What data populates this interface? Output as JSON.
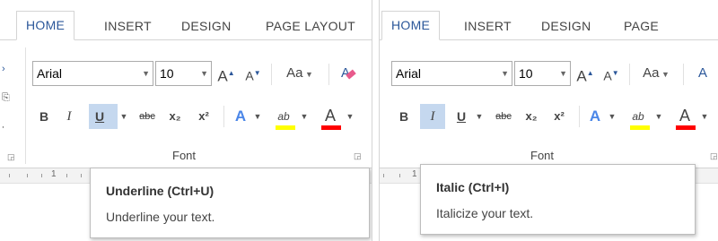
{
  "tabs": [
    "HOME",
    "INSERT",
    "DESIGN",
    "PAGE LAYOUT"
  ],
  "font_name": "Arial",
  "font_size": "10",
  "grow_label": "A",
  "shrink_label": "A",
  "case_label": "Aa",
  "clear_label": "A",
  "bold_label": "B",
  "italic_label": "I",
  "underline_label": "U",
  "strike_label": "abc",
  "sub_label": "x₂",
  "sup_label": "x²",
  "effect_label": "A",
  "highlight_label": "ab",
  "fontcolor_label": "A",
  "group_label": "Font",
  "ruler_mark": "1",
  "left_panel": {
    "pressed_command": "underline",
    "tooltip_title": "Underline (Ctrl+U)",
    "tooltip_desc": "Underline your text."
  },
  "right_panel": {
    "pressed_command": "italic",
    "tooltip_title": "Italic (Ctrl+I)",
    "tooltip_desc": "Italicize your text."
  },
  "colors": {
    "accent": "#2b579a",
    "highlight_bar": "#ffff00",
    "font_color_bar": "#ff0000",
    "pressed_bg": "#c5d8ef"
  }
}
